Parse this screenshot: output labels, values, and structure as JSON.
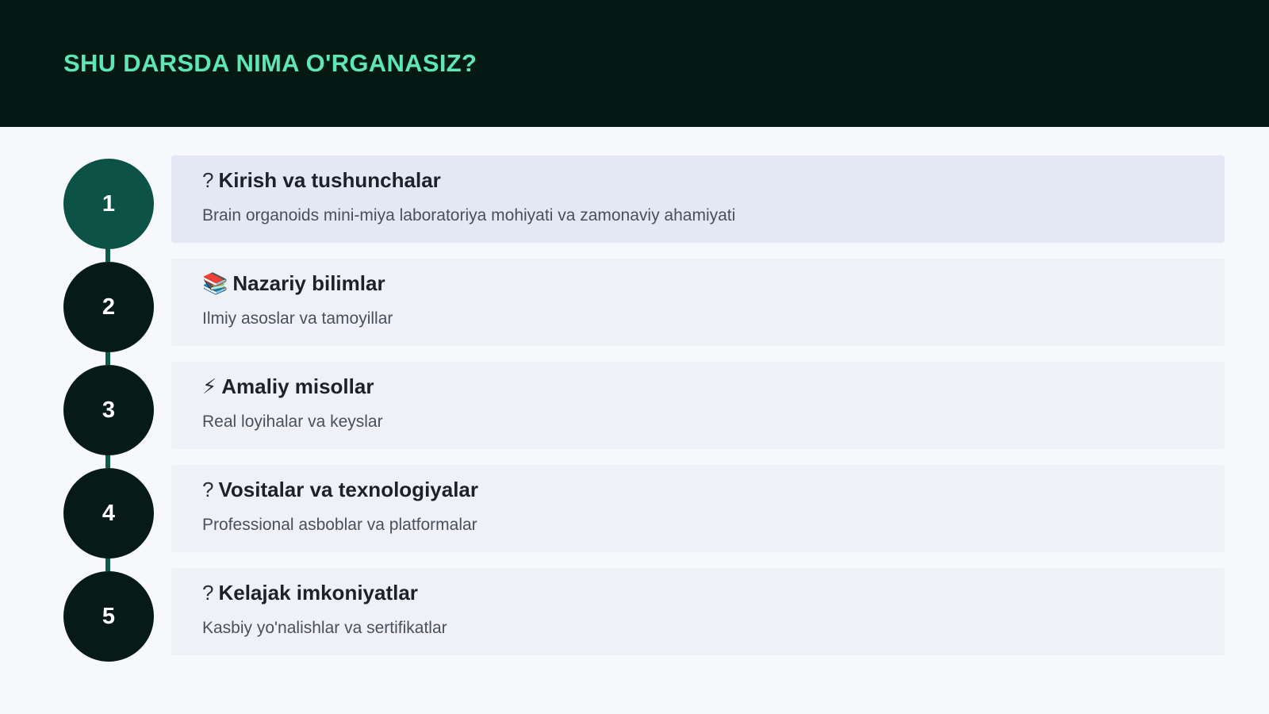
{
  "header": {
    "title": "SHU DARSDA NIMA O'RGANASIZ?"
  },
  "colors": {
    "header_bg": "#041814",
    "title_accent": "#5ee6b4",
    "active_circle": "#0d5246",
    "circle": "#061a17",
    "connector": "#0d5a48"
  },
  "steps": [
    {
      "number": "1",
      "icon": "?",
      "icon_name": "unknown-glyph-icon",
      "title": "Kirish va tushunchalar",
      "description": "Brain organoids mini-miya laboratoriya mohiyati va zamonaviy ahamiyati",
      "active": true
    },
    {
      "number": "2",
      "icon": "📚",
      "icon_name": "books-icon",
      "title": "Nazariy bilimlar",
      "description": "Ilmiy asoslar va tamoyillar",
      "active": false
    },
    {
      "number": "3",
      "icon": "⚡",
      "icon_name": "lightning-icon",
      "title": "Amaliy misollar",
      "description": "Real loyihalar va keyslar",
      "active": false
    },
    {
      "number": "4",
      "icon": "?",
      "icon_name": "unknown-glyph-icon",
      "title": "Vositalar va texnologiyalar",
      "description": "Professional asboblar va platformalar",
      "active": false
    },
    {
      "number": "5",
      "icon": "?",
      "icon_name": "unknown-glyph-icon",
      "title": "Kelajak imkoniyatlar",
      "description": "Kasbiy yo'nalishlar va sertifikatlar",
      "active": false
    }
  ]
}
